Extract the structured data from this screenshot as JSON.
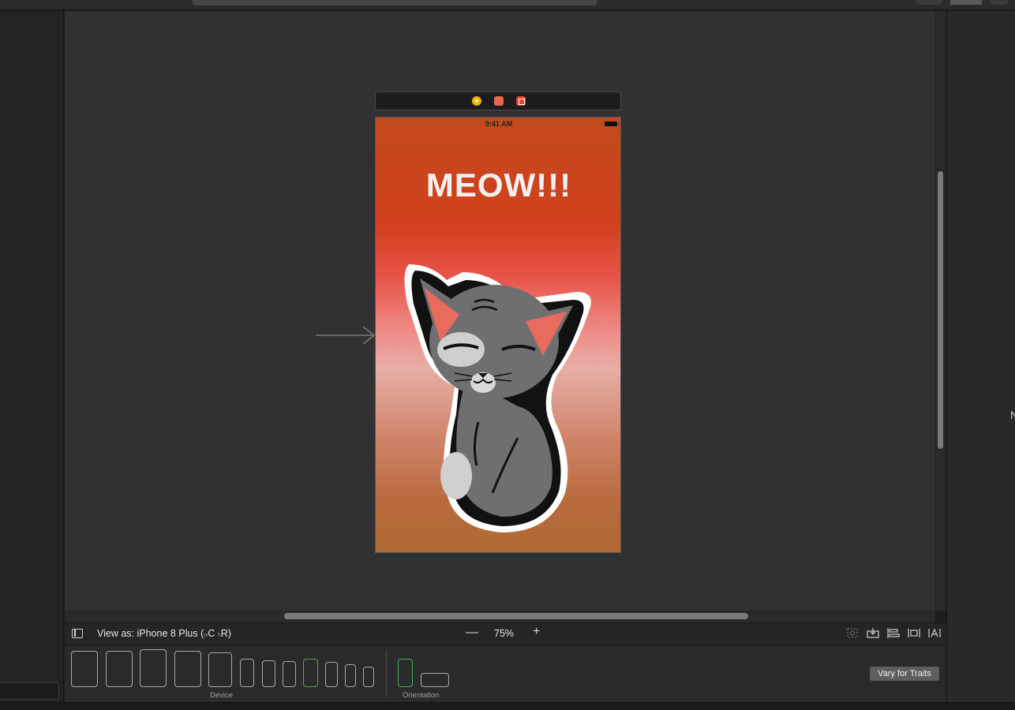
{
  "scene": {
    "status_time": "9:41 AM",
    "label_text": "MEOW!!!",
    "dock_icons": [
      "view-controller-icon",
      "first-responder-icon",
      "exit-icon"
    ],
    "image_semantic": "cat-sticker"
  },
  "bottom_bar": {
    "view_as_prefix": "View as: iPhone 8 Plus (",
    "size_w_prefix": "w",
    "size_w": "C",
    "size_h_prefix": "h",
    "size_h": "R",
    "size_suffix": ")",
    "zoom_out": "—",
    "zoom_level": "75%",
    "zoom_in": "+"
  },
  "device_bar": {
    "device_label": "Device",
    "orientation_label": "Orientation",
    "vary_traits_label": "Vary for Traits",
    "selected_device_index": 7,
    "selected_orientation": "portrait"
  },
  "colors": {
    "accent_selected": "#3fb34f",
    "canvas": "#313133",
    "label_text": "#f4f1f0"
  }
}
